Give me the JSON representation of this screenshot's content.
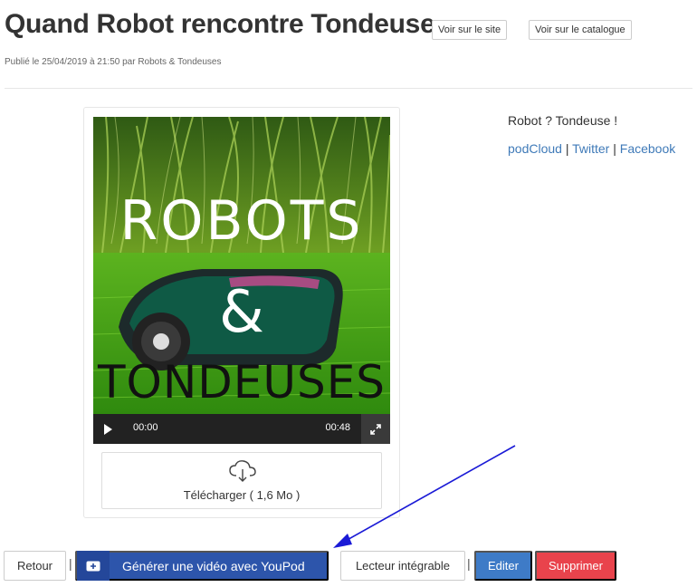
{
  "header": {
    "title": "Quand Robot rencontre Tondeuse",
    "btn_site": "Voir sur le site",
    "btn_catalogue": "Voir sur le catalogue"
  },
  "meta": "Publié le 25/04/2019 à 21:50 par Robots & Tondeuses",
  "cover": {
    "line1": "ROBOTS",
    "line2": "&",
    "line3": "TONDEUSES",
    "colors": {
      "sky": "#8fbf3a",
      "grass": "#3e9a12",
      "robot": "#0d4a3a"
    }
  },
  "player": {
    "current": "00:00",
    "duration": "00:48",
    "play_icon": "play-icon",
    "fullscreen_icon": "fullscreen-icon"
  },
  "download": {
    "label": "Télécharger ( 1,6 Mo )",
    "icon": "cloud-download-icon"
  },
  "side": {
    "description": "Robot ? Tondeuse !",
    "links": [
      "podCloud",
      "Twitter",
      "Facebook"
    ],
    "separator": "|"
  },
  "footer": {
    "retour": "Retour",
    "separator": "|",
    "youpod": "Générer une vidéo avec YouPod",
    "lecteur": "Lecteur intégrable",
    "editer": "Editer",
    "supprimer": "Supprimer"
  },
  "colors": {
    "primary": "#2d55ab",
    "editer": "#3e7bc7",
    "danger": "#e9434c",
    "link": "#3f7ab8",
    "arrow": "#1a1ad6"
  }
}
